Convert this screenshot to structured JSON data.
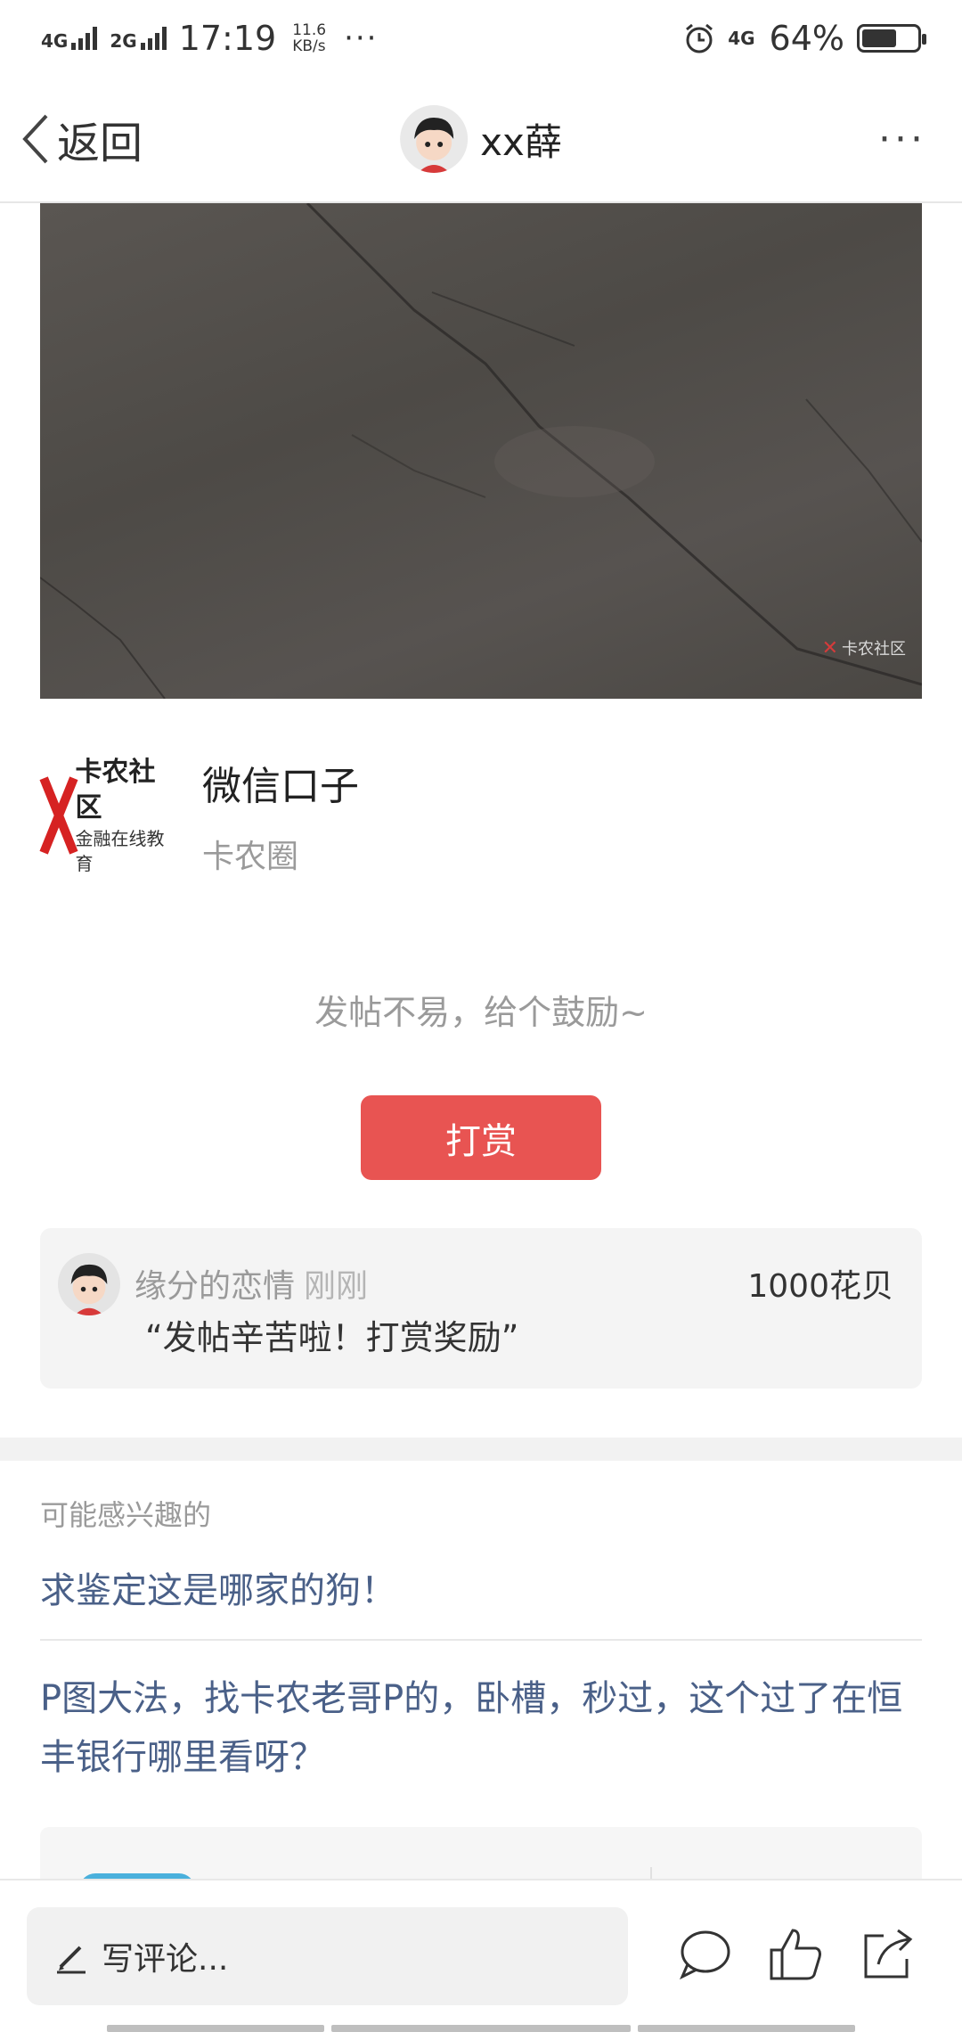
{
  "status_bar": {
    "network1": "4G",
    "network2": "2G",
    "time": "17:19",
    "speed_value": "11.6",
    "speed_unit": "KB/s",
    "more": "···",
    "network3": "4G",
    "battery_percent": "64%",
    "battery_level": 0.64
  },
  "nav": {
    "back_label": "返回",
    "username": "xx薛",
    "more": "···"
  },
  "hero": {
    "watermark": "卡农社区"
  },
  "card": {
    "logo_text_main": "卡农社区",
    "logo_text_sub": "金融在线教育",
    "title": "微信口子",
    "subtitle": "卡农圈"
  },
  "encourage_text": "发帖不易，给个鼓励~",
  "reward_button": "打赏",
  "reward_record": {
    "user": "缘分的恋情",
    "time": "刚刚",
    "amount": "1000花贝",
    "message": "“发帖辛苦啦！打赏奖励”"
  },
  "recommend": {
    "title": "可能感兴趣的",
    "items": [
      "求鉴定这是哪家的狗！",
      "P图大法，找卡农老哥P的，卧槽，秒过，这个过了在恒丰银行哪里看呀？"
    ]
  },
  "bottom_bar": {
    "comment_placeholder": "写评论..."
  }
}
